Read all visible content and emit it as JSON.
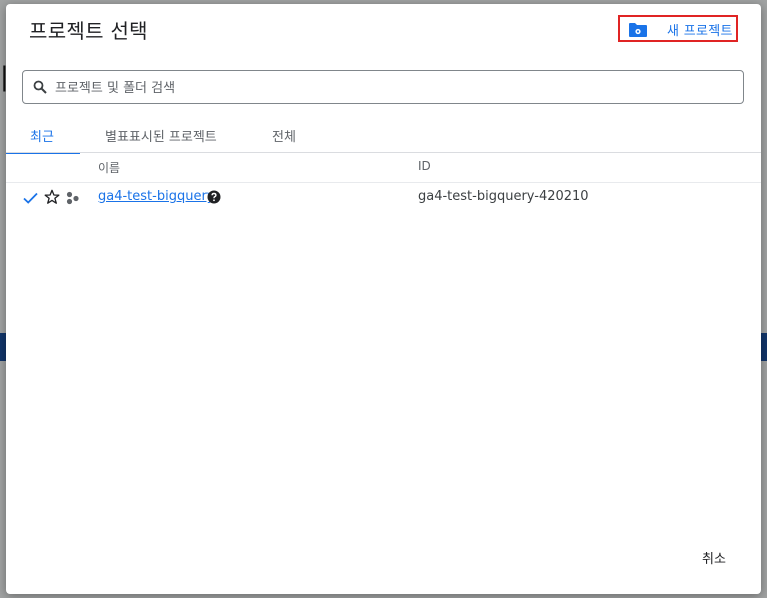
{
  "dialog": {
    "title": "프로젝트 선택",
    "new_project_label": "새 프로젝트",
    "search": {
      "placeholder": "프로젝트 및 폴더 검색"
    },
    "tabs": [
      {
        "label": "최근",
        "active": true
      },
      {
        "label": "별표표시된 프로젝트",
        "active": false
      },
      {
        "label": "전체",
        "active": false
      }
    ],
    "table": {
      "columns": {
        "name": "이름",
        "id": "ID"
      },
      "rows": [
        {
          "name": "ga4-test-bigquery",
          "id": "ga4-test-bigquery-420210",
          "selected": true,
          "starred": false
        }
      ]
    },
    "cancel_label": "취소"
  },
  "colors": {
    "accent": "#1a73e8",
    "highlight_border": "#e02424",
    "folder_icon": "#1a73e8"
  }
}
